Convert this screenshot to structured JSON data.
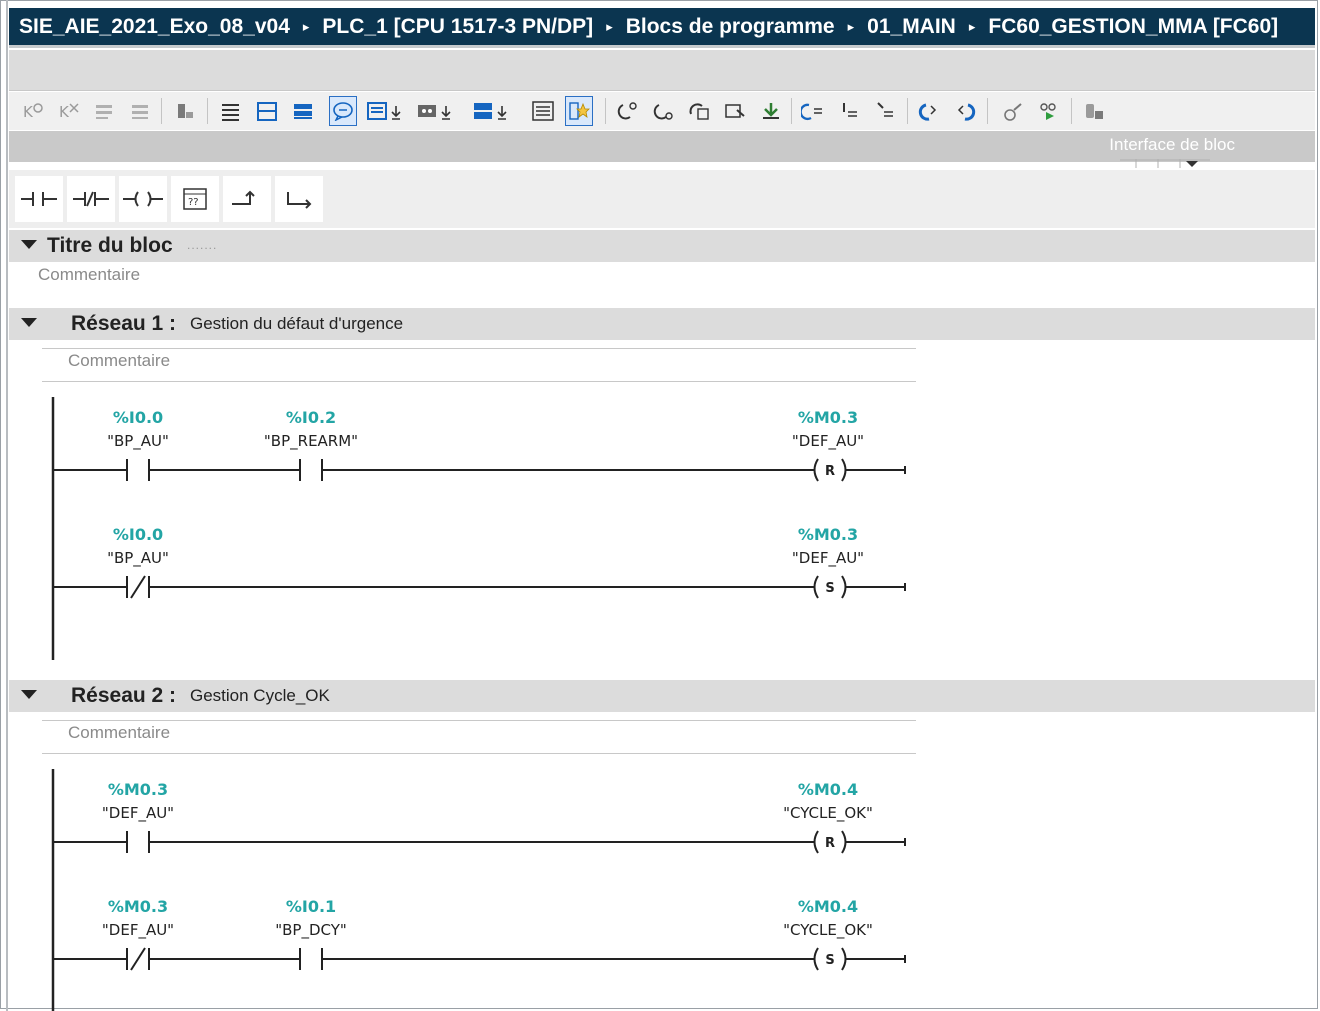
{
  "breadcrumb": {
    "items": [
      "SIE_AIE_2021_Exo_08_v04",
      "PLC_1 [CPU 1517-3 PN/DP]",
      "Blocs de programme",
      "01_MAIN",
      "FC60_GESTION_MMA [FC60]"
    ],
    "separator": "▸"
  },
  "toolbar": {
    "icons": [
      "go-online-icon",
      "go-offline-icon",
      "insert-network-icon",
      "delete-network-icon",
      "monitor-icon",
      "insert-row-icon",
      "add-row-icon",
      "open-all-networks-icon",
      "close-all-networks-icon",
      "show-comments-icon",
      "favorites-icon",
      "absolute-operands-icon",
      "symbolic-operands-icon",
      "network-overview-icon",
      "show-favorites-icon",
      "jump-previous-icon",
      "jump-next-icon",
      "compare-icon",
      "test-icon",
      "download-icon",
      "call-structure-icon",
      "assignment-icon",
      "cross-ref-icon",
      "go-to-next-icon",
      "go-to-prev-icon",
      "force-icon",
      "modify-icon",
      "monitor-all-icon"
    ]
  },
  "interface_label": "Interface de bloc",
  "instructions": [
    "normally-open-contact-icon",
    "normally-closed-contact-icon",
    "output-coil-icon",
    "empty-box-icon",
    "open-branch-icon",
    "close-branch-icon"
  ],
  "block": {
    "title": "Titre du bloc",
    "comment": "Commentaire"
  },
  "networks": [
    {
      "label": "Réseau 1 :",
      "description": "Gestion du défaut d'urgence",
      "comment": "Commentaire",
      "rungs": [
        {
          "contacts": [
            {
              "address": "%I0.0",
              "symbol": "\"BP_AU\"",
              "type": "NO"
            },
            {
              "address": "%I0.2",
              "symbol": "\"BP_REARM\"",
              "type": "NO"
            }
          ],
          "coil": {
            "address": "%M0.3",
            "symbol": "\"DEF_AU\"",
            "letter": "R"
          }
        },
        {
          "contacts": [
            {
              "address": "%I0.0",
              "symbol": "\"BP_AU\"",
              "type": "NC"
            }
          ],
          "coil": {
            "address": "%M0.3",
            "symbol": "\"DEF_AU\"",
            "letter": "S"
          }
        }
      ]
    },
    {
      "label": "Réseau 2 :",
      "description": "Gestion Cycle_OK",
      "comment": "Commentaire",
      "rungs": [
        {
          "contacts": [
            {
              "address": "%M0.3",
              "symbol": "\"DEF_AU\"",
              "type": "NO"
            }
          ],
          "coil": {
            "address": "%M0.4",
            "symbol": "\"CYCLE_OK\"",
            "letter": "R"
          }
        },
        {
          "contacts": [
            {
              "address": "%M0.3",
              "symbol": "\"DEF_AU\"",
              "type": "NC"
            },
            {
              "address": "%I0.1",
              "symbol": "\"BP_DCY\"",
              "type": "NO"
            }
          ],
          "coil": {
            "address": "%M0.4",
            "symbol": "\"CYCLE_OK\"",
            "letter": "S"
          }
        }
      ]
    }
  ],
  "colors": {
    "breadcrumb_bg": "#0b3550",
    "address_teal": "#23a5a5",
    "section_gray": "#dcdcdc"
  }
}
